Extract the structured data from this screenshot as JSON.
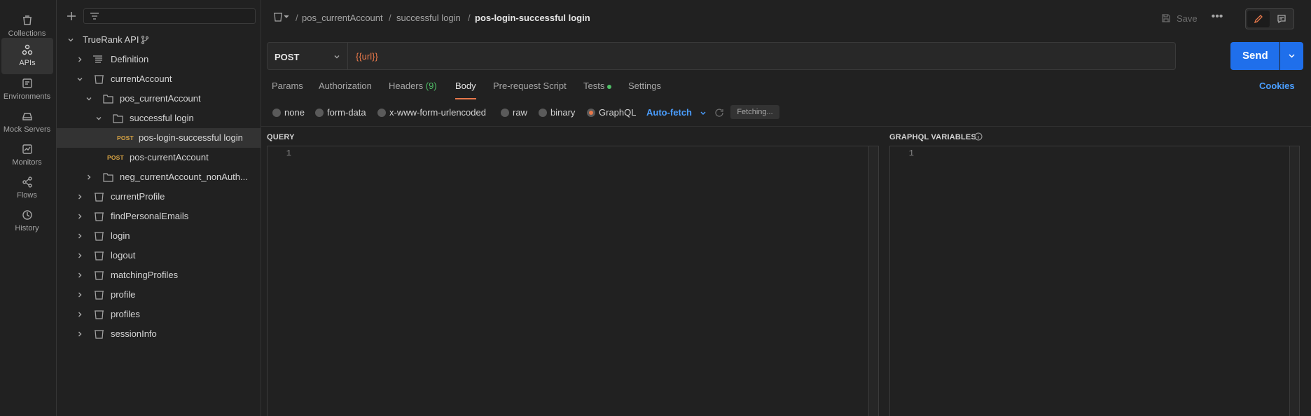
{
  "rail": {
    "items": [
      {
        "label": "Collections",
        "icon": "collections-icon"
      },
      {
        "label": "APIs",
        "icon": "apis-icon",
        "active": true
      },
      {
        "label": "Environments",
        "icon": "environments-icon"
      },
      {
        "label": "Mock Servers",
        "icon": "mock-servers-icon"
      },
      {
        "label": "Monitors",
        "icon": "monitors-icon"
      },
      {
        "label": "Flows",
        "icon": "flows-icon"
      },
      {
        "label": "History",
        "icon": "history-icon"
      }
    ]
  },
  "tree": {
    "root": "TrueRank API",
    "definition": "Definition",
    "currentAccount": "currentAccount",
    "pos_currentAccount": "pos_currentAccount",
    "successful_login": "successful login",
    "req1_method": "POST",
    "req1_name": "pos-login-successful login",
    "req2_method": "POST",
    "req2_name": "pos-currentAccount",
    "neg_folder": "neg_currentAccount_nonAuth...",
    "collections": [
      "currentProfile",
      "findPersonalEmails",
      "login",
      "logout",
      "matchingProfiles",
      "profile",
      "profiles",
      "sessionInfo"
    ]
  },
  "breadcrumb": {
    "part1": "pos_currentAccount",
    "part2": "successful login",
    "current": "pos-login-successful login",
    "sep": "/"
  },
  "toolbar": {
    "save_label": "Save",
    "more_label": "•••"
  },
  "request": {
    "method": "POST",
    "url": "{{url}}",
    "send_label": "Send"
  },
  "tabs": {
    "params": "Params",
    "authorization": "Authorization",
    "headers": "Headers",
    "headers_count": "(9)",
    "body": "Body",
    "prerequest": "Pre-request Script",
    "tests": "Tests",
    "settings": "Settings",
    "cookies": "Cookies"
  },
  "body_types": {
    "none": "none",
    "form_data": "form-data",
    "urlencoded": "x-www-form-urlencoded",
    "raw": "raw",
    "binary": "binary",
    "graphql": "GraphQL",
    "selected": "GraphQL",
    "autofetch": "Auto-fetch",
    "fetching": "Fetching..."
  },
  "editors": {
    "query_title": "QUERY",
    "variables_title": "GRAPHQL VARIABLES",
    "query_line": "1",
    "variables_line": "1"
  },
  "colors": {
    "accent": "#e8784a",
    "primary": "#1f6feb",
    "link": "#4a9eff",
    "method_post": "#d9a444",
    "success": "#4fbf67"
  }
}
